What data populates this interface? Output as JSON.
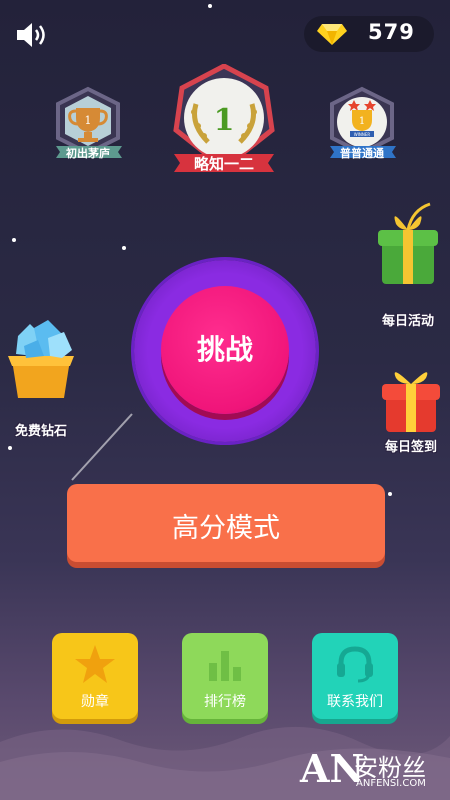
{
  "topbar": {
    "sound_icon": "speaker-icon",
    "diamond_icon": "diamond-icon",
    "diamond_count": "579"
  },
  "badges": [
    {
      "label": "初出茅庐",
      "rank": "1"
    },
    {
      "label": "略知一二",
      "rank": "1"
    },
    {
      "label": "普普通通",
      "rank": "1",
      "sub": "WINNER"
    }
  ],
  "side": {
    "daily_activity": "每日活动",
    "free_diamonds": "免费钻石",
    "daily_signin": "每日签到"
  },
  "main": {
    "challenge": "挑战",
    "high_score_mode": "高分模式"
  },
  "bottom": [
    {
      "label": "勋章",
      "icon": "star-icon",
      "color": "#f7c619"
    },
    {
      "label": "排行榜",
      "icon": "bar-chart-icon",
      "color": "#8ed95a"
    },
    {
      "label": "联系我们",
      "icon": "headset-icon",
      "color": "#22d3b8"
    }
  ],
  "watermark": {
    "logo": "AN",
    "text": "安粉丝",
    "url": "ANFENSI.COM"
  },
  "colors": {
    "challenge_pink": "#f0157a",
    "ring_purple": "#8a2be2",
    "high_score_orange": "#f9704a"
  }
}
